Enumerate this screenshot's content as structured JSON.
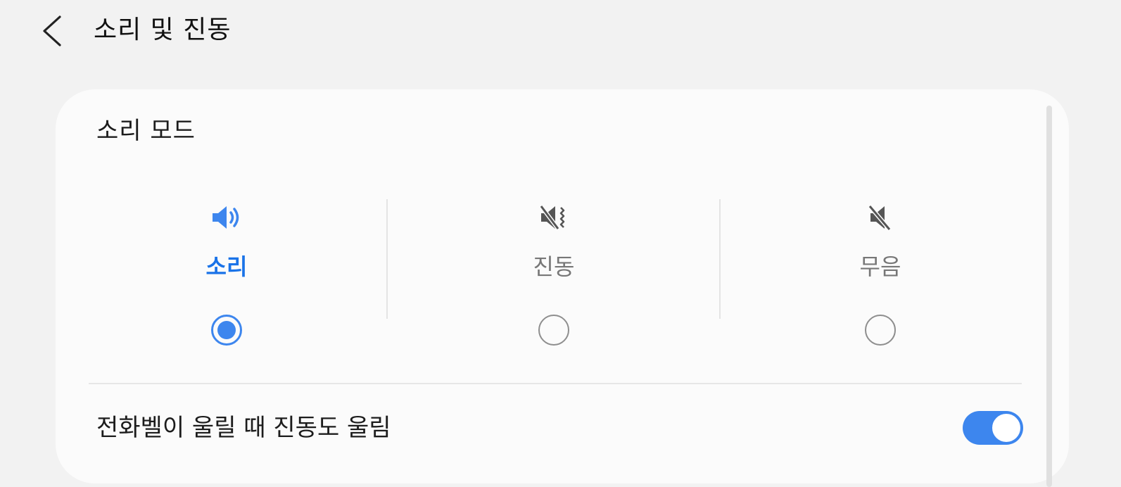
{
  "header": {
    "title": "소리 및 진동",
    "back_icon": "chevron-left-icon"
  },
  "sound_mode": {
    "section_title": "소리 모드",
    "options": [
      {
        "label": "소리",
        "icon": "speaker-volume-icon",
        "selected": true
      },
      {
        "label": "진동",
        "icon": "vibrate-mute-icon",
        "selected": false
      },
      {
        "label": "무음",
        "icon": "speaker-mute-icon",
        "selected": false
      }
    ]
  },
  "settings": {
    "vibrate_while_ringing_label": "전화벨이 울릴 때 진동도 울림",
    "vibrate_while_ringing_enabled": true
  },
  "colors": {
    "accent": "#3d86ee",
    "active_label": "#1a73e8",
    "inactive_label": "#777777",
    "background": "#f2f2f2",
    "card": "#fbfbfb"
  }
}
